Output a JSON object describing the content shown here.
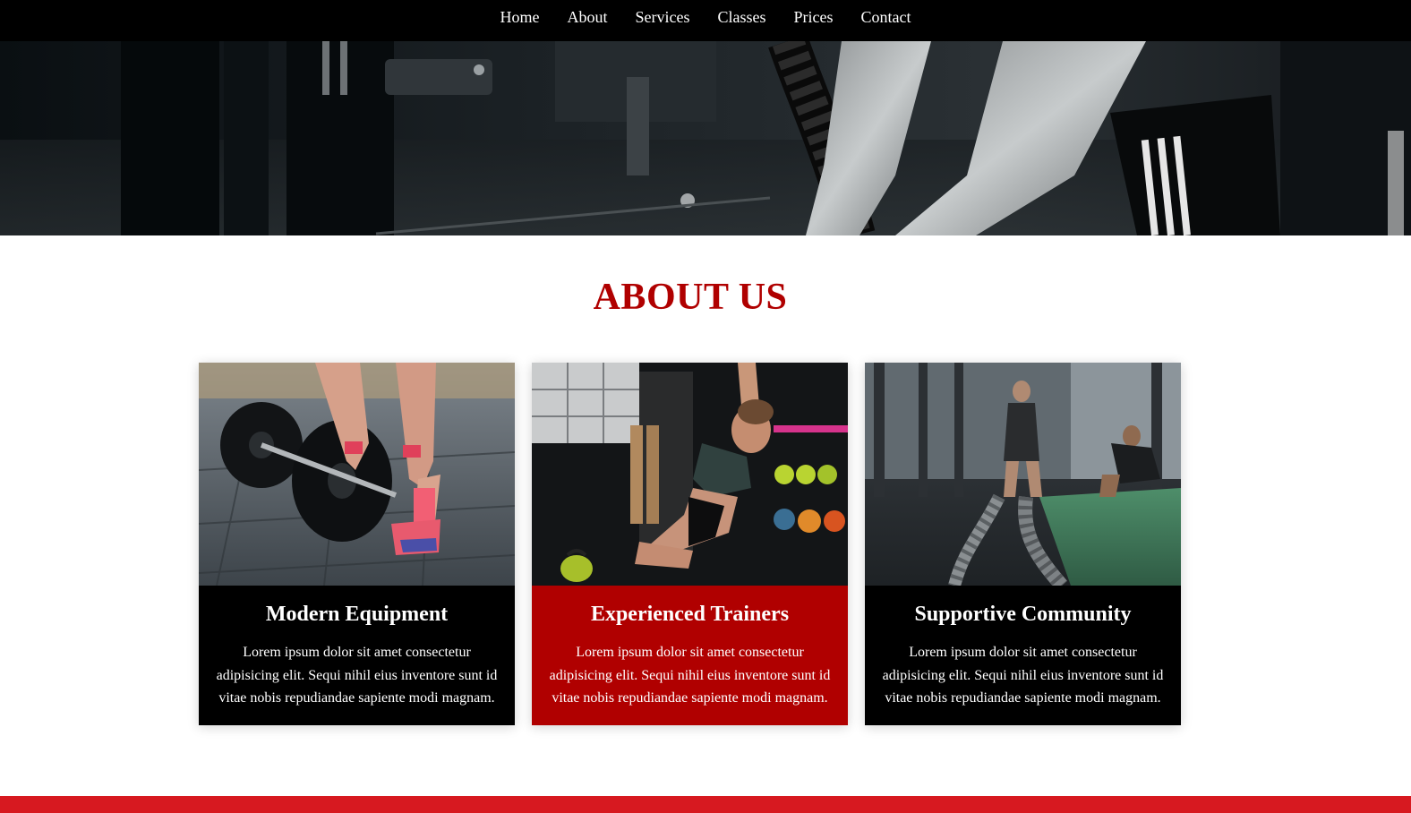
{
  "nav": {
    "items": [
      "Home",
      "About",
      "Services",
      "Classes",
      "Prices",
      "Contact"
    ]
  },
  "about": {
    "title": "ABOUT US",
    "cards": [
      {
        "title": "Modern Equipment",
        "text": "Lorem ipsum dolor sit amet consectetur adipisicing elit. Sequi nihil eius inventore sunt id vitae nobis repudiandae sapiente modi magnam.",
        "style": "dark"
      },
      {
        "title": "Experienced Trainers",
        "text": "Lorem ipsum dolor sit amet consectetur adipisicing elit. Sequi nihil eius inventore sunt id vitae nobis repudiandae sapiente modi magnam.",
        "style": "red"
      },
      {
        "title": "Supportive Community",
        "text": "Lorem ipsum dolor sit amet consectetur adipisicing elit. Sequi nihil eius inventore sunt id vitae nobis repudiandae sapiente modi magnam.",
        "style": "dark"
      }
    ]
  },
  "colors": {
    "navbar_bg": "#000000",
    "accent_red": "#b00000",
    "footer_red": "#d71920",
    "card_dark": "#000000"
  }
}
